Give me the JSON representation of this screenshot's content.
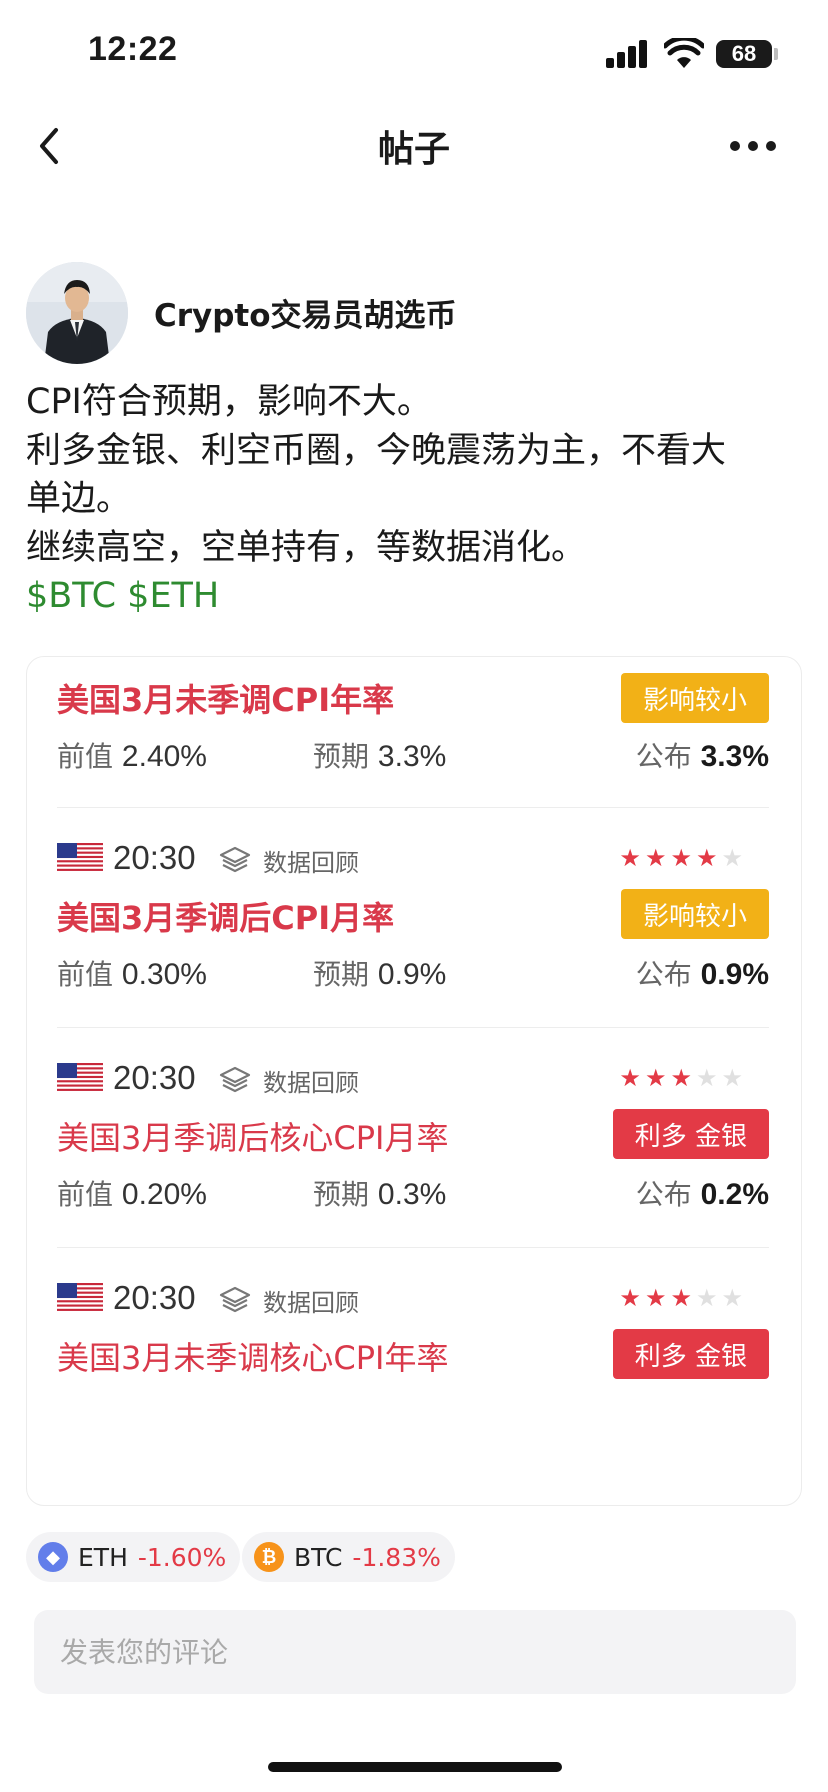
{
  "status_bar": {
    "time": "12:22",
    "battery": "68"
  },
  "nav": {
    "title": "帖子"
  },
  "author": {
    "name": "Crypto交易员胡选币"
  },
  "post": {
    "lines": [
      "CPI符合预期，影响不大。",
      "利多金银、利空币圈，今晚震荡为主，不看大",
      "单边。",
      "继续高空，空单持有，等数据消化。"
    ],
    "tags": "$BTC $ETH"
  },
  "data_card": {
    "entries": [
      {
        "title": "美国3月未季调CPI年率",
        "impact": "影响较小",
        "impact_color": "#f2b117",
        "previous_label": "前值",
        "previous": "2.40%",
        "forecast_label": "预期",
        "forecast": "3.3%",
        "actual_label": "公布",
        "actual": "3.3%"
      },
      {
        "time": "20:30",
        "review": "数据回顾",
        "stars": 4,
        "stars_max": 5,
        "title": "美国3月季调后CPI月率",
        "impact": "影响较小",
        "impact_color": "#f2b117",
        "previous_label": "前值",
        "previous": "0.30%",
        "forecast_label": "预期",
        "forecast": "0.9%",
        "actual_label": "公布",
        "actual": "0.9%"
      },
      {
        "time": "20:30",
        "review": "数据回顾",
        "stars": 3,
        "stars_max": 5,
        "title": "美国3月季调后核心CPI月率",
        "impact": "利多 金银",
        "impact_color": "#e33a46",
        "previous_label": "前值",
        "previous": "0.20%",
        "forecast_label": "预期",
        "forecast": "0.3%",
        "actual_label": "公布",
        "actual": "0.2%"
      },
      {
        "time": "20:30",
        "review": "数据回顾",
        "stars": 3,
        "stars_max": 5,
        "title": "美国3月未季调核心CPI年率",
        "impact": "利多 金银",
        "impact_color": "#e33a46"
      }
    ]
  },
  "coins": [
    {
      "symbol": "ETH",
      "change": "-1.60%",
      "icon": "ethereum-icon",
      "color": "#627eea"
    },
    {
      "symbol": "BTC",
      "change": "-1.83%",
      "icon": "bitcoin-icon",
      "color": "#f7931a"
    }
  ],
  "comment": {
    "placeholder": "发表您的评论"
  },
  "colors": {
    "accent_red": "#e33a46",
    "tag_green": "#2e8b30",
    "badge_yellow": "#f2b117"
  }
}
